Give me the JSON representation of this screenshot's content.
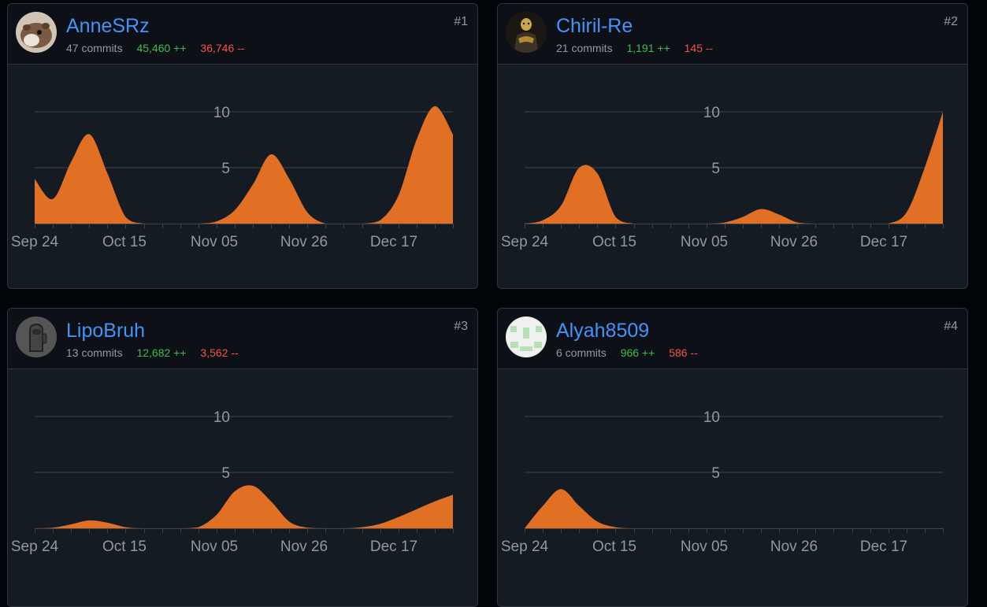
{
  "contributors": [
    {
      "rank": "#1",
      "username": "AnneSRz",
      "commits": "47 commits",
      "additions": "45,460 ++",
      "deletions": "36,746 --",
      "avatar": "hamster-photo-avatar",
      "weekly_commits": [
        4,
        2.2,
        5.5,
        8,
        4.5,
        0.6,
        0,
        0,
        0,
        0,
        0.2,
        1.2,
        3.5,
        6.2,
        4,
        1,
        0,
        0,
        0,
        0.3,
        2.5,
        7.5,
        10.5,
        8
      ]
    },
    {
      "rank": "#2",
      "username": "Chiril-Re",
      "commits": "21 commits",
      "additions": "1,191 ++",
      "deletions": "145 --",
      "avatar": "dark-character-avatar",
      "weekly_commits": [
        0,
        0.3,
        1.6,
        5,
        4.5,
        0.6,
        0,
        0,
        0,
        0,
        0,
        0.1,
        0.6,
        1.3,
        0.8,
        0.1,
        0,
        0,
        0,
        0,
        0,
        1,
        5,
        10
      ]
    },
    {
      "rank": "#3",
      "username": "LipoBruh",
      "commits": "13 commits",
      "additions": "12,682 ++",
      "deletions": "3,562 --",
      "avatar": "astronaut-avatar",
      "weekly_commits": [
        0,
        0.05,
        0.35,
        0.7,
        0.5,
        0.1,
        0,
        0,
        0,
        0.1,
        1.2,
        3.3,
        3.8,
        2.4,
        0.6,
        0.05,
        0,
        0,
        0.1,
        0.4,
        1,
        1.7,
        2.4,
        3
      ]
    },
    {
      "rank": "#4",
      "username": "Alyah8509",
      "commits": "6 commits",
      "additions": "966 ++",
      "deletions": "586 --",
      "avatar": "identicon-avatar",
      "weekly_commits": [
        0,
        2,
        3.5,
        2,
        0.6,
        0.1,
        0,
        0,
        0,
        0,
        0,
        0,
        0,
        0,
        0,
        0,
        0,
        0,
        0,
        0,
        0,
        0,
        0,
        0
      ]
    }
  ],
  "chart_data": [
    {
      "type": "area",
      "title": "AnneSRz",
      "x_ticks": [
        "Sep 24",
        "Oct 15",
        "Nov 05",
        "Nov 26",
        "Dec 17"
      ],
      "y_ticks": [
        5,
        10
      ],
      "ylim": [
        0,
        11
      ],
      "color": "#e16f24"
    },
    {
      "type": "area",
      "title": "Chiril-Re",
      "x_ticks": [
        "Sep 24",
        "Oct 15",
        "Nov 05",
        "Nov 26",
        "Dec 17"
      ],
      "y_ticks": [
        5,
        10
      ],
      "ylim": [
        0,
        11
      ],
      "color": "#e16f24"
    },
    {
      "type": "area",
      "title": "LipoBruh",
      "x_ticks": [
        "Sep 24",
        "Oct 15",
        "Nov 05",
        "Nov 26",
        "Dec 17"
      ],
      "y_ticks": [
        5,
        10
      ],
      "ylim": [
        0,
        11
      ],
      "color": "#e16f24"
    },
    {
      "type": "area",
      "title": "Alyah8509",
      "x_ticks": [
        "Sep 24",
        "Oct 15",
        "Nov 05",
        "Nov 26",
        "Dec 17"
      ],
      "y_ticks": [
        5,
        10
      ],
      "ylim": [
        0,
        11
      ],
      "color": "#e16f24"
    }
  ],
  "colors": {
    "accent": "#4493f8",
    "additions": "#3fb950",
    "deletions": "#f85149",
    "area": "#e16f24"
  }
}
